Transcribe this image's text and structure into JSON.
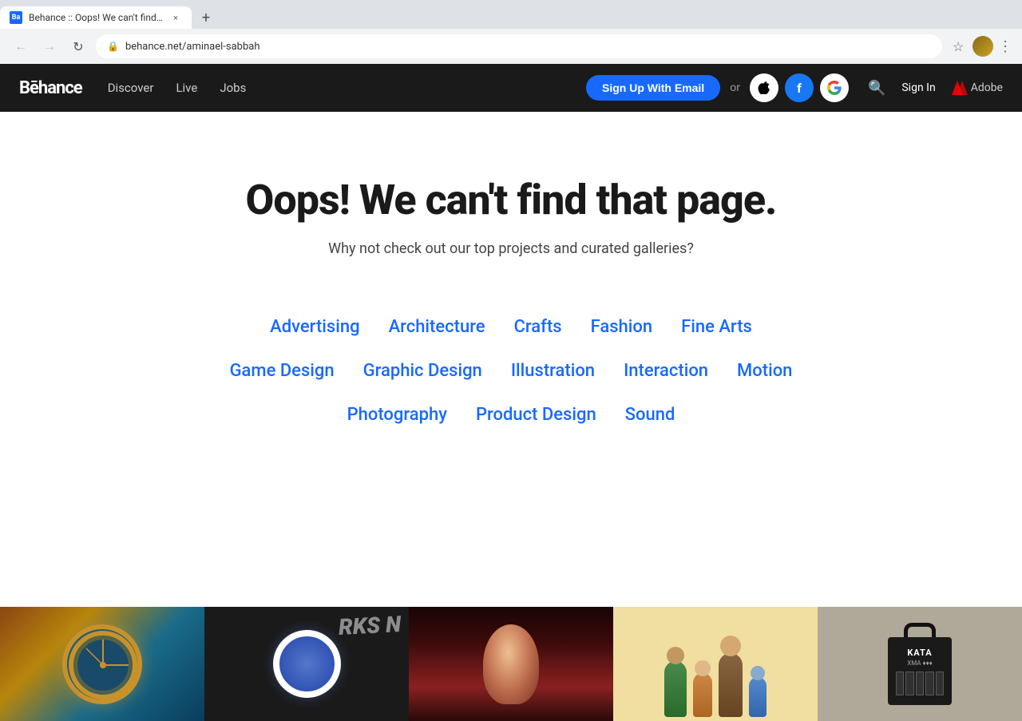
{
  "browser": {
    "tab": {
      "favicon": "Ba",
      "title": "Behance :: Oops! We can't find...",
      "close_label": "×"
    },
    "new_tab_label": "+",
    "toolbar": {
      "back_label": "←",
      "forward_label": "→",
      "reload_label": "↻",
      "url": "behance.net/aminael-sabbah",
      "star_label": "☆",
      "menu_label": "⋮"
    }
  },
  "nav": {
    "logo": "Bēhance",
    "links": [
      {
        "label": "Discover"
      },
      {
        "label": "Live"
      },
      {
        "label": "Jobs"
      }
    ],
    "signup_button": "Sign Up With Email",
    "or_text": "or",
    "apple_label": "",
    "facebook_label": "f",
    "google_label": "G",
    "signin_label": "Sign In",
    "adobe_label": "Adobe",
    "search_label": "🔍"
  },
  "main": {
    "heading": "Oops! We can't find that page.",
    "subtext": "Why not check out our top projects and curated galleries?",
    "categories_row1": [
      {
        "label": "Advertising"
      },
      {
        "label": "Architecture"
      },
      {
        "label": "Crafts"
      },
      {
        "label": "Fashion"
      },
      {
        "label": "Fine Arts"
      }
    ],
    "categories_row2": [
      {
        "label": "Game Design"
      },
      {
        "label": "Graphic Design"
      },
      {
        "label": "Illustration"
      },
      {
        "label": "Interaction"
      },
      {
        "label": "Motion"
      }
    ],
    "categories_row3": [
      {
        "label": "Photography"
      },
      {
        "label": "Product Design"
      },
      {
        "label": "Sound"
      }
    ]
  },
  "colors": {
    "nav_bg": "#1a1a1a",
    "signup_bg": "#1769ff",
    "link_color": "#1769ff",
    "text_dark": "#1a1a1a"
  }
}
